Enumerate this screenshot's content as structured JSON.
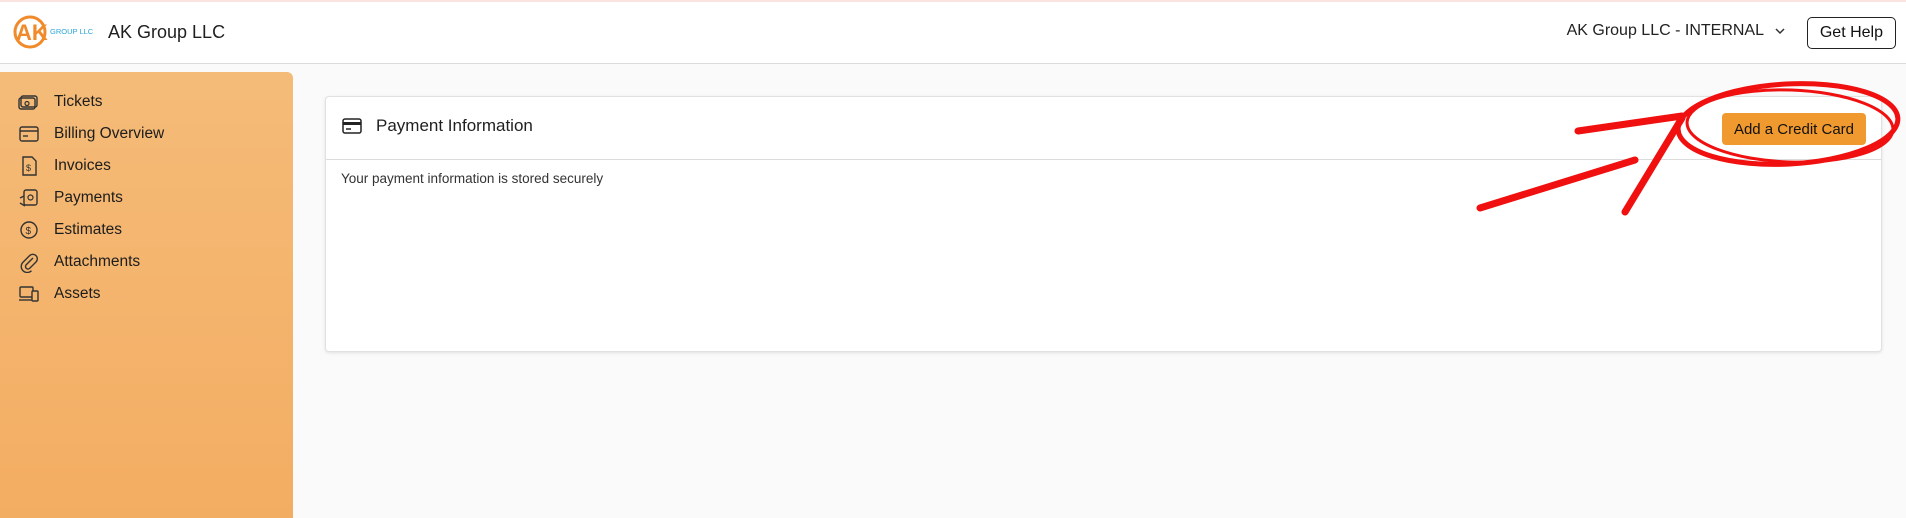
{
  "header": {
    "logo_text_main": "AK",
    "logo_text_sub": "GROUP LLC",
    "company_name": "AK Group LLC",
    "org_selector": "AK Group LLC - INTERNAL",
    "help_label": "Get Help"
  },
  "sidebar": {
    "items": [
      {
        "label": "Tickets",
        "icon": "tickets-icon"
      },
      {
        "label": "Billing Overview",
        "icon": "billing-icon"
      },
      {
        "label": "Invoices",
        "icon": "invoice-icon"
      },
      {
        "label": "Payments",
        "icon": "payments-icon"
      },
      {
        "label": "Estimates",
        "icon": "estimates-icon"
      },
      {
        "label": "Attachments",
        "icon": "paperclip-icon"
      },
      {
        "label": "Assets",
        "icon": "assets-icon"
      }
    ]
  },
  "main": {
    "card_title": "Payment Information",
    "add_card_label": "Add a Credit Card",
    "body_text": "Your payment information is stored securely"
  },
  "colors": {
    "sidebar_top": "#f4bb78",
    "sidebar_bottom": "#f3ad62",
    "accent_button": "#f0992e",
    "annotation_red": "#f01010",
    "logo_orange": "#f18a2a",
    "logo_blue": "#2aa6d8"
  }
}
